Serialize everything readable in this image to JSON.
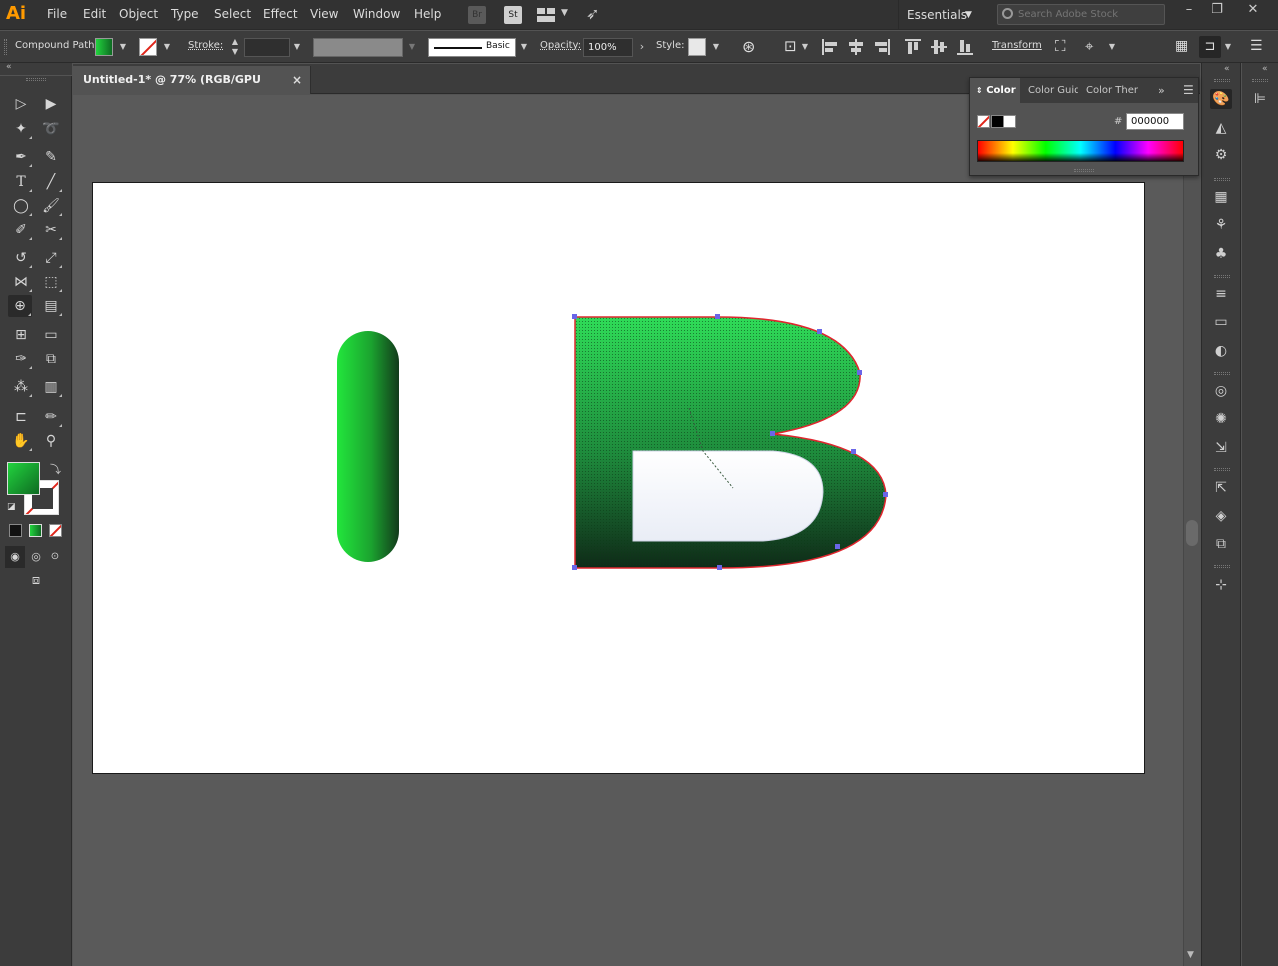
{
  "app": {
    "logo": "Ai"
  },
  "menu": [
    "File",
    "Edit",
    "Object",
    "Type",
    "Select",
    "Effect",
    "View",
    "Window",
    "Help"
  ],
  "menu_icons": {
    "bridge": "Br",
    "stock": "St"
  },
  "workspace": {
    "label": "Essentials"
  },
  "stock_search": {
    "placeholder": "Search Adobe Stock"
  },
  "control_bar": {
    "selection_label": "Compound Path",
    "stroke_label": "Stroke:",
    "brush_label": "Basic",
    "opacity_label": "Opacity:",
    "opacity_value": "100%",
    "style_label": "Style:",
    "transform_label": "Transform"
  },
  "document": {
    "tab_title": "Untitled-1* @ 77% (RGB/GPU Preview)",
    "close_glyph": "×"
  },
  "color_panel": {
    "tabs": [
      "Color",
      "Color Guid",
      "Color Ther"
    ],
    "hex_label": "#",
    "hex_value": "000000"
  },
  "colors": {
    "ui_dark": "#323232",
    "ui_mid": "#3c3c3c",
    "canvas": "#5a5a5a",
    "artboard": "#ffffff",
    "gradient_light": "#22e63c",
    "gradient_dark": "#123a1b",
    "path_outline": "#e0262e",
    "anchor": "#6a66e8"
  }
}
